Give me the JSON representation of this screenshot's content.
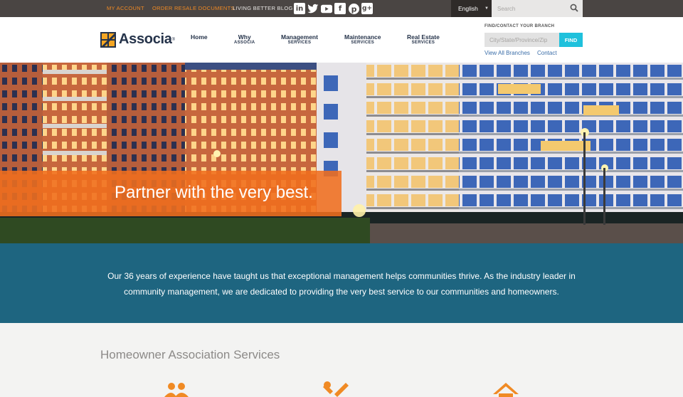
{
  "topbar": {
    "my_account": "MY ACCOUNT",
    "order_resale": "ORDER RESALE DOCUMENTS",
    "blog": "LIVING BETTER BLOG",
    "social_icons": [
      "linkedin-icon",
      "twitter-icon",
      "youtube-icon",
      "facebook-icon",
      "pinterest-icon",
      "google-plus-icon"
    ],
    "language": "English",
    "search_placeholder": "Search"
  },
  "header": {
    "brand": "Associa",
    "nav": [
      {
        "line1": "Home",
        "line2": ""
      },
      {
        "line1": "Why",
        "line2": "ASSOCIA"
      },
      {
        "line1": "Management",
        "line2": "SERVICES"
      },
      {
        "line1": "Maintenance",
        "line2": "SERVICES"
      },
      {
        "line1": "Real Estate",
        "line2": "SERVICES"
      }
    ],
    "branch": {
      "title": "FIND/CONTACT YOUR BRANCH",
      "placeholder": "City/State/Province/Zip",
      "button": "FIND",
      "view_all": "View All Branches",
      "contact": "Contact"
    }
  },
  "hero": {
    "tagline": "Partner with the very best."
  },
  "intro": {
    "text": "Our 36 years of experience have taught us that exceptional management helps communities thrive. As the industry leader in community management, we are dedicated to providing the very best service to our communities and homeowners."
  },
  "services": {
    "title": "Homeowner Association Services",
    "icons": [
      "people-icon",
      "tools-icon",
      "house-icon"
    ]
  },
  "colors": {
    "topbar": "#4a4543",
    "accent_orange": "#f08a24",
    "teal": "#1e6580",
    "find_button": "#1fc1dc",
    "brand_navy": "#25334a"
  }
}
